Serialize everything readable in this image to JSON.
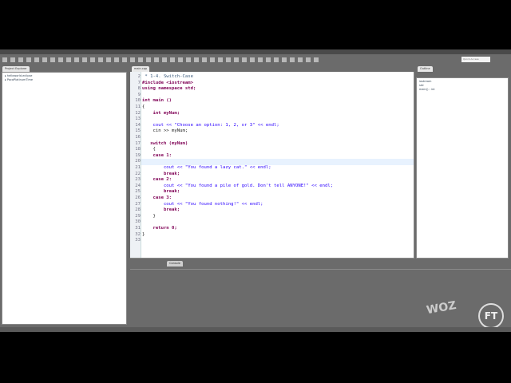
{
  "toolbar": {
    "search_placeholder": "Quick Access"
  },
  "project_explorer": {
    "tab": "Project Explorer",
    "items": [
      "helloworld-eclipse",
      "PacaPlatinumTime"
    ]
  },
  "editor": {
    "tab": "main.cpp",
    "lines": [
      {
        "n": "2",
        "t": " * 1-4. Switch-Case",
        "c": "cm"
      },
      {
        "n": "7",
        "t": "#include <iostream>",
        "c": "kw"
      },
      {
        "n": "8",
        "t": "using namespace std;",
        "c": "kw"
      },
      {
        "n": "9",
        "t": ""
      },
      {
        "n": "10",
        "t": "int main ()"
      },
      {
        "n": "11",
        "t": "{"
      },
      {
        "n": "12",
        "t": "    int myNum;"
      },
      {
        "n": "13",
        "t": ""
      },
      {
        "n": "14",
        "t": "    cout << \"Choose an option: 1, 2, or 3\" << endl;"
      },
      {
        "n": "15",
        "t": "    cin >> myNum;"
      },
      {
        "n": "16",
        "t": ""
      },
      {
        "n": "17",
        "t": "   switch (myNum)"
      },
      {
        "n": "18",
        "t": "    {"
      },
      {
        "n": "19",
        "t": "    case 1:"
      },
      {
        "n": "20",
        "t": ""
      },
      {
        "n": "21",
        "t": "        cout << \"You found a lazy cat.\" << endl;"
      },
      {
        "n": "22",
        "t": "        break;"
      },
      {
        "n": "23",
        "t": "    case 2:"
      },
      {
        "n": "24",
        "t": "        cout << \"You found a pile of gold. Don't tell ANYONE!\" << endl;"
      },
      {
        "n": "25",
        "t": "        break;"
      },
      {
        "n": "26",
        "t": "    case 3:"
      },
      {
        "n": "27",
        "t": "        cout << \"You found nothing!\" << endl;"
      },
      {
        "n": "28",
        "t": "        break;"
      },
      {
        "n": "29",
        "t": "    }"
      },
      {
        "n": "30",
        "t": ""
      },
      {
        "n": "31",
        "t": "    return 0;"
      },
      {
        "n": "32",
        "t": "}"
      },
      {
        "n": "33",
        "t": ""
      }
    ]
  },
  "outline": {
    "tab": "Outline",
    "items": [
      "iostream",
      "std",
      "main() : int"
    ]
  },
  "console": {
    "tab": "Console"
  },
  "watermark": {
    "logo1": "WOZ",
    "logo2": "FT"
  }
}
